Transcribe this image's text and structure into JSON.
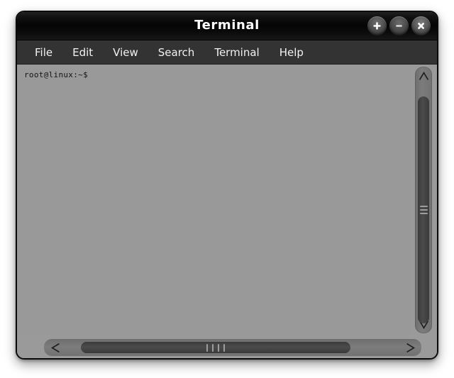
{
  "window": {
    "title": "Terminal",
    "controls": [
      {
        "name": "maximize-button",
        "glyph": "+",
        "label": "Maximize"
      },
      {
        "name": "minimize-button",
        "glyph": "−",
        "label": "Minimize"
      },
      {
        "name": "close-button",
        "glyph": "×",
        "label": "Close"
      }
    ]
  },
  "menubar": {
    "items": [
      {
        "label": "File"
      },
      {
        "label": "Edit"
      },
      {
        "label": "View"
      },
      {
        "label": "Search"
      },
      {
        "label": "Terminal"
      },
      {
        "label": "Help"
      }
    ]
  },
  "terminal": {
    "prompt": "root@linux:~$",
    "lines": [
      "root@linux:~$"
    ]
  },
  "scrollbars": {
    "vertical": {
      "up_arrow": "scroll-up-arrow",
      "down_arrow": "scroll-down-arrow",
      "thumb": "vertical-scroll-thumb"
    },
    "horizontal": {
      "left_arrow": "scroll-left-arrow",
      "right_arrow": "scroll-right-arrow",
      "thumb": "horizontal-scroll-thumb"
    }
  },
  "colors": {
    "titlebar": "#0a0a0a",
    "menubar": "#333333",
    "terminal_background": "#999999",
    "terminal_text": "#141414",
    "chrome": "#9a9a9a",
    "scroll_thumb": "#434343",
    "scroll_track": "#767676",
    "page_background": "#ffffff"
  }
}
